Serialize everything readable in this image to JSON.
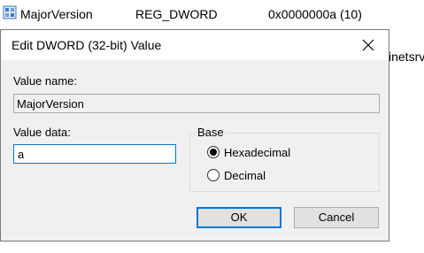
{
  "background_list": {
    "name": "MajorVersion",
    "type": "REG_DWORD",
    "data": "0x0000000a (10)",
    "partial_next_text": "inetsrv"
  },
  "dialog": {
    "title": "Edit DWORD (32-bit) Value",
    "value_name_label": "Value name:",
    "value_name": "MajorVersion",
    "value_data_label": "Value data:",
    "value_data": "a",
    "base_label": "Base",
    "radio_hex_label": "Hexadecimal",
    "radio_dec_label": "Decimal",
    "selected_base": "Hexadecimal",
    "ok_label": "OK",
    "cancel_label": "Cancel"
  },
  "colors": {
    "focus_border": "#0078d7",
    "dialog_bg": "#f0f0f0"
  },
  "icons": {
    "registry_value": "dword-value-icon",
    "close": "close-icon"
  }
}
